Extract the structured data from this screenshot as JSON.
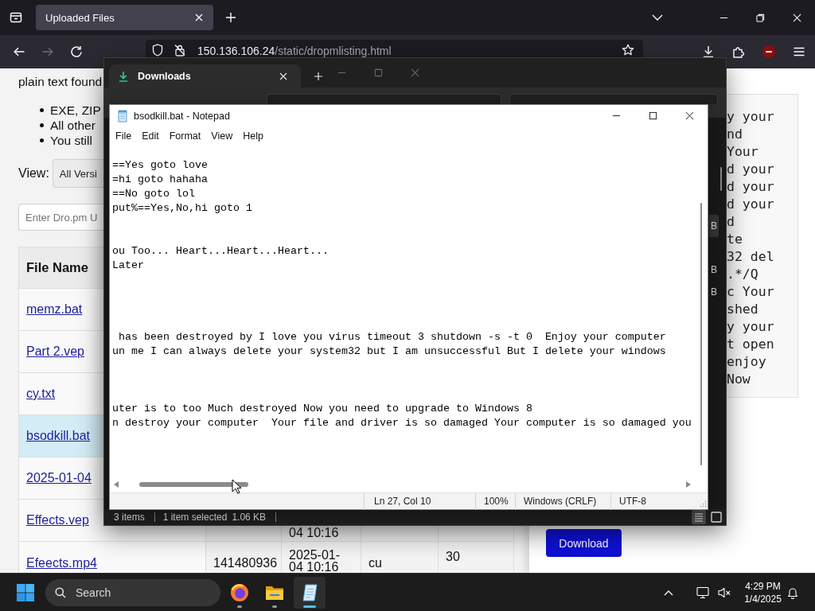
{
  "browser": {
    "tab": {
      "title": "Uploaded Files",
      "selected": true
    },
    "nav_buttons": [
      {
        "kind": "back",
        "disabled": false
      },
      {
        "kind": "forward",
        "disabled": true
      },
      {
        "kind": "reload",
        "disabled": false
      }
    ],
    "url": {
      "host": "150.136.106.24",
      "path": "/static/dropmlisting.html"
    }
  },
  "page": {
    "intro": "plain text found",
    "bullets": [
      "EXE, ZIP",
      "All other",
      "You still"
    ],
    "view": {
      "label": "View:",
      "value": "All Versi"
    },
    "url_input": {
      "placeholder": "Enter Dro.pm U"
    },
    "table": {
      "columns": [
        "File Name"
      ],
      "rows": [
        {
          "file": "memz.bat",
          "selected": false
        },
        {
          "file": "Part 2.vep",
          "selected": false
        },
        {
          "file": "cy.txt",
          "selected": false
        },
        {
          "file": "bsodkill.bat",
          "selected": true
        },
        {
          "file": "2025-01-04",
          "selected": false
        },
        {
          "file": "Effects.vep",
          "selected": false,
          "date_tail": "04 10:16"
        },
        {
          "file": "Efeects.mp4",
          "selected": false,
          "size": "141480936",
          "date": "2025-01-04 10:16",
          "column_4": "cu",
          "column_5": "30"
        }
      ]
    },
    "preview_lines": [
      "y your",
      "nd",
      "Your",
      "d your",
      "d your",
      "d your",
      "d",
      "te",
      "32 del",
      ".*/Q",
      "c Your",
      "shed",
      "y your",
      "t open",
      "enjoy",
      "Now"
    ],
    "download_button": "Download"
  },
  "downloads_window": {
    "title": "Downloads",
    "items": [
      {
        "size": "B",
        "selected": true
      },
      {
        "size": "B",
        "selected": false
      },
      {
        "size": "B",
        "selected": false
      }
    ],
    "status": {
      "count": "3 items",
      "selection": "1 item selected",
      "size": "1.06 KB"
    },
    "views": [
      {
        "kind": "list",
        "selected": true
      },
      {
        "kind": "tiles",
        "selected": false
      }
    ]
  },
  "notepad": {
    "title": "bsodkill.bat - Notepad",
    "menu": [
      "File",
      "Edit",
      "Format",
      "View",
      "Help"
    ],
    "lines": [
      {
        "kind": "text",
        "text": "==Yes goto love"
      },
      {
        "kind": "text",
        "text": "=hi goto hahaha"
      },
      {
        "kind": "text",
        "text": "==No goto lol"
      },
      {
        "kind": "text",
        "text": "put%==Yes,No,hi goto 1"
      },
      {
        "kind": "blank"
      },
      {
        "kind": "blank"
      },
      {
        "kind": "text",
        "text": "ou Too... Heart...Heart...Heart..."
      },
      {
        "kind": "text",
        "text": "Later"
      },
      {
        "kind": "blank"
      },
      {
        "kind": "blank"
      },
      {
        "kind": "blank"
      },
      {
        "kind": "blank"
      },
      {
        "kind": "text",
        "text": " has been destroyed by I love you virus timeout 3 shutdown -s -t 0  Enjoy your computer"
      },
      {
        "kind": "text",
        "text": "un me I can always delete your system32 but I am unsuccessful But I delete your windows"
      },
      {
        "kind": "blank"
      },
      {
        "kind": "blank"
      },
      {
        "kind": "blank"
      },
      {
        "kind": "text",
        "text": "uter is to too Much destroyed Now you need to upgrade to Windows 8"
      },
      {
        "kind": "text",
        "text": "n destroy your computer  Your file and driver is so damaged Your computer is so damaged you"
      }
    ],
    "status": {
      "position": "Ln 27, Col 10",
      "zoom": "100%",
      "line_ending": "Windows (CRLF)",
      "encoding": "UTF-8"
    }
  },
  "taskbar": {
    "search": {
      "label": "Search"
    },
    "apps": [
      {
        "kind": "browser",
        "selected": false
      },
      {
        "kind": "folder",
        "selected": false
      },
      {
        "kind": "notepad",
        "selected": true
      }
    ],
    "time": "4:29 PM",
    "date": "1/4/2025"
  }
}
